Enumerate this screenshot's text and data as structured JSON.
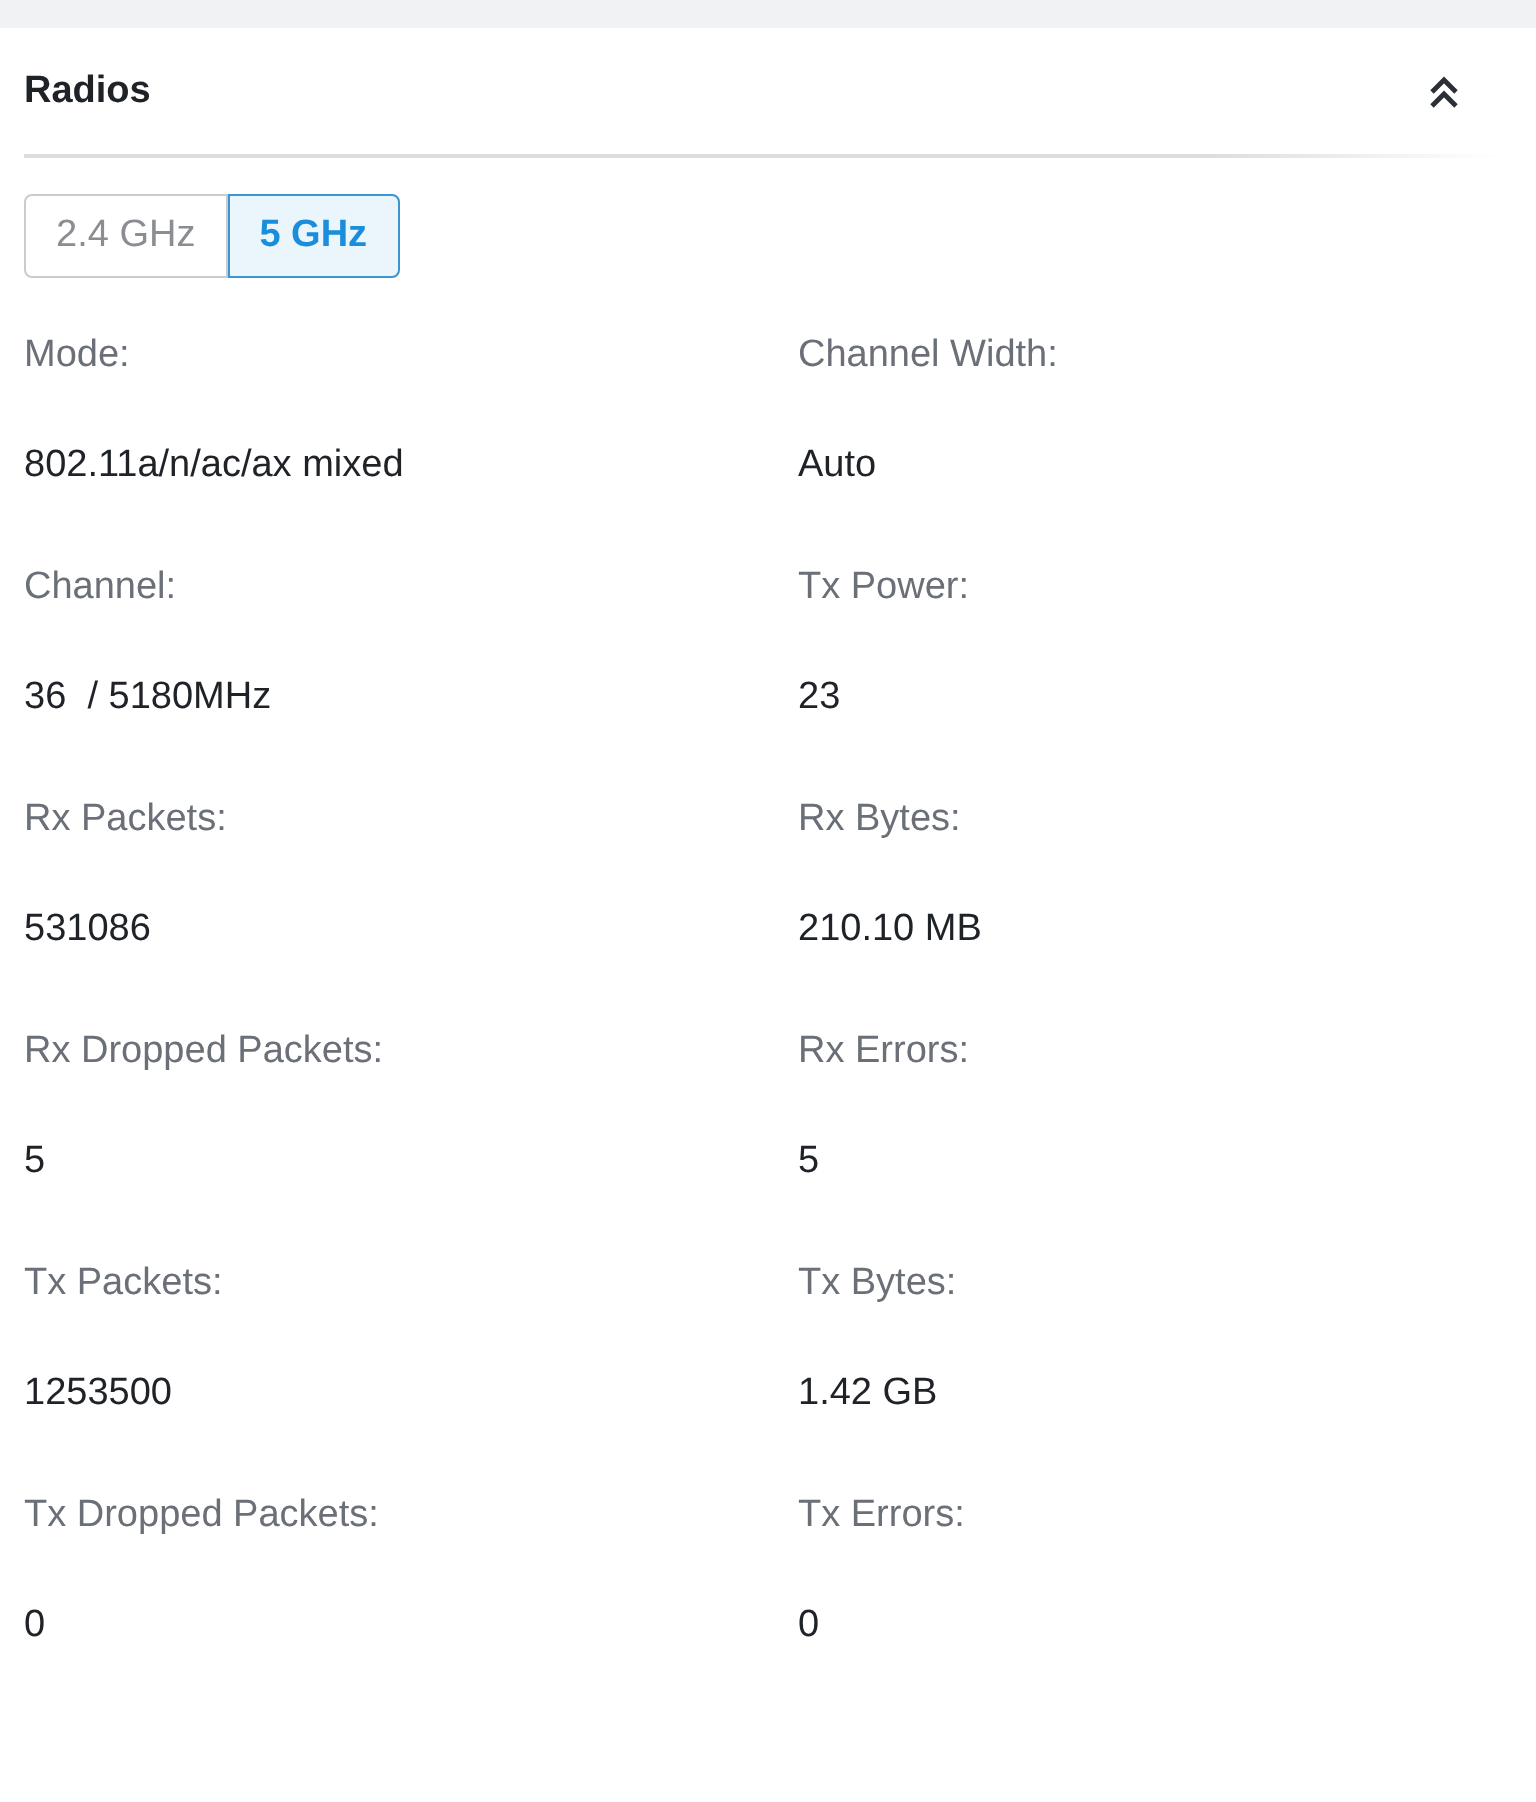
{
  "panel": {
    "title": "Radios",
    "expanded": true
  },
  "tabs": [
    {
      "label": "2.4 GHz",
      "selected": false
    },
    {
      "label": "5 GHz",
      "selected": true
    }
  ],
  "fields": [
    {
      "label": "Mode:",
      "value": "802.11a/n/ac/ax mixed"
    },
    {
      "label": "Channel Width:",
      "value": "Auto"
    },
    {
      "label": "Channel:",
      "value": "36  / 5180MHz"
    },
    {
      "label": "Tx Power:",
      "value": "23"
    },
    {
      "label": "Rx Packets:",
      "value": "531086"
    },
    {
      "label": "Rx Bytes:",
      "value": "210.10 MB"
    },
    {
      "label": "Rx Dropped Packets:",
      "value": "5"
    },
    {
      "label": "Rx Errors:",
      "value": "5"
    },
    {
      "label": "Tx Packets:",
      "value": "1253500"
    },
    {
      "label": "Tx Bytes:",
      "value": "1.42 GB"
    },
    {
      "label": "Tx Dropped Packets:",
      "value": "0"
    },
    {
      "label": "Tx Errors:",
      "value": "0"
    }
  ]
}
